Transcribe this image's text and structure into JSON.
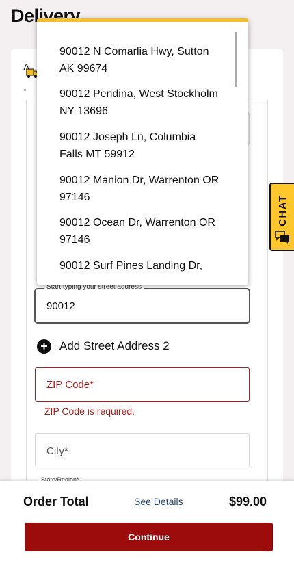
{
  "page": {
    "title": "Delivery"
  },
  "form": {
    "fragment_label": "A",
    "street": {
      "label": "Start typing your street address",
      "value": "90012"
    },
    "add_street2_label": "Add Street Address 2",
    "zip": {
      "placeholder": "ZIP Code*",
      "error": "ZIP Code is required.",
      "error_color": "#b01c1c"
    },
    "city": {
      "placeholder": "City*"
    },
    "state": {
      "label": "State/Region*"
    }
  },
  "autocomplete": {
    "accent_color": "#f3bf2a",
    "suggestions": [
      {
        "line1": "90012 N Comarlia Hwy, Sutton",
        "line2": "AK 99674"
      },
      {
        "line1": "90012 Pendina, West Stockholm",
        "line2": "NY 13696"
      },
      {
        "line1": "90012 Joseph Ln, Columbia",
        "line2": "Falls MT 59912"
      },
      {
        "line1": "90012 Manion Dr, Warrenton OR",
        "line2": "97146"
      },
      {
        "line1": "90012 Ocean Dr, Warrenton OR",
        "line2": "97146"
      },
      {
        "line1": "90012 Surf Pines Landing Dr,",
        "line2": ""
      }
    ]
  },
  "chat": {
    "label": "CHAT",
    "icon": "chat-bubbles-icon",
    "color": "#ffc72c"
  },
  "footer": {
    "order_total_label": "Order Total",
    "see_details_label": "See Details",
    "price": "$99.00",
    "continue_label": "Continue",
    "continue_color": "#9d0c0c"
  }
}
